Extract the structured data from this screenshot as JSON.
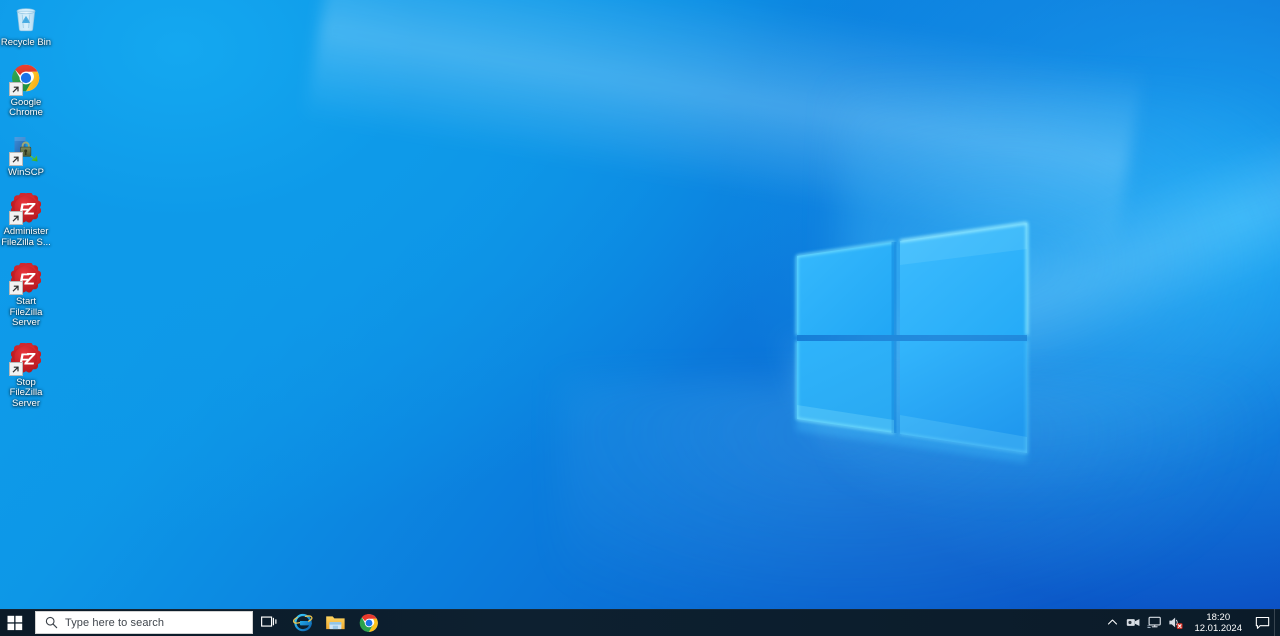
{
  "desktop": {
    "wallpaper_name": "windows-10-hero-logo",
    "colors": {
      "top_left": "#0ea0ec",
      "bottom_right": "#0b4ec3",
      "logo_pane": "#2bb3fb",
      "logo_edge_glow": "#5fe6ff",
      "taskbar": "#0c1d2b"
    },
    "icons": [
      {
        "name": "recycle-bin",
        "label": "Recycle Bin",
        "icon": "recycle-bin-icon",
        "shortcut": false
      },
      {
        "name": "google-chrome",
        "label": "Google Chrome",
        "icon": "chrome-icon",
        "shortcut": true
      },
      {
        "name": "winscp",
        "label": "WinSCP",
        "icon": "winscp-icon",
        "shortcut": true
      },
      {
        "name": "administer-filezilla",
        "label": "Administer FileZilla S...",
        "icon": "filezilla-server-icon",
        "shortcut": true
      },
      {
        "name": "start-filezilla-server",
        "label": "Start FileZilla Server",
        "icon": "filezilla-server-icon",
        "shortcut": true
      },
      {
        "name": "stop-filezilla-server",
        "label": "Stop FileZilla Server",
        "icon": "filezilla-server-icon",
        "shortcut": true
      }
    ]
  },
  "taskbar": {
    "start_label": "Start",
    "search": {
      "placeholder": "Type here to search",
      "icon": "search-icon"
    },
    "buttons": [
      {
        "name": "task-view",
        "label": "Task View",
        "icon": "task-view-icon"
      },
      {
        "name": "internet-explorer",
        "label": "Internet Explorer",
        "icon": "internet-explorer-icon"
      },
      {
        "name": "file-explorer",
        "label": "File Explorer",
        "icon": "file-explorer-icon"
      },
      {
        "name": "chrome-taskbar",
        "label": "Google Chrome",
        "icon": "chrome-icon"
      }
    ],
    "tray": {
      "overflow_icon": "chevron-up-icon",
      "icons": [
        {
          "name": "vmware-tools",
          "label": "VMware Tools",
          "icon": "vmware-tools-icon"
        },
        {
          "name": "network",
          "label": "Network",
          "icon": "network-monitor-icon"
        },
        {
          "name": "volume-muted",
          "label": "Speakers: Muted",
          "icon": "speaker-muted-icon"
        }
      ],
      "clock": {
        "time": "18:20",
        "date": "12.01.2024"
      },
      "notifications": {
        "name": "action-center",
        "label": "Notifications",
        "icon": "action-center-icon"
      },
      "show_desktop": {
        "name": "show-desktop",
        "label": "Show desktop"
      }
    }
  }
}
